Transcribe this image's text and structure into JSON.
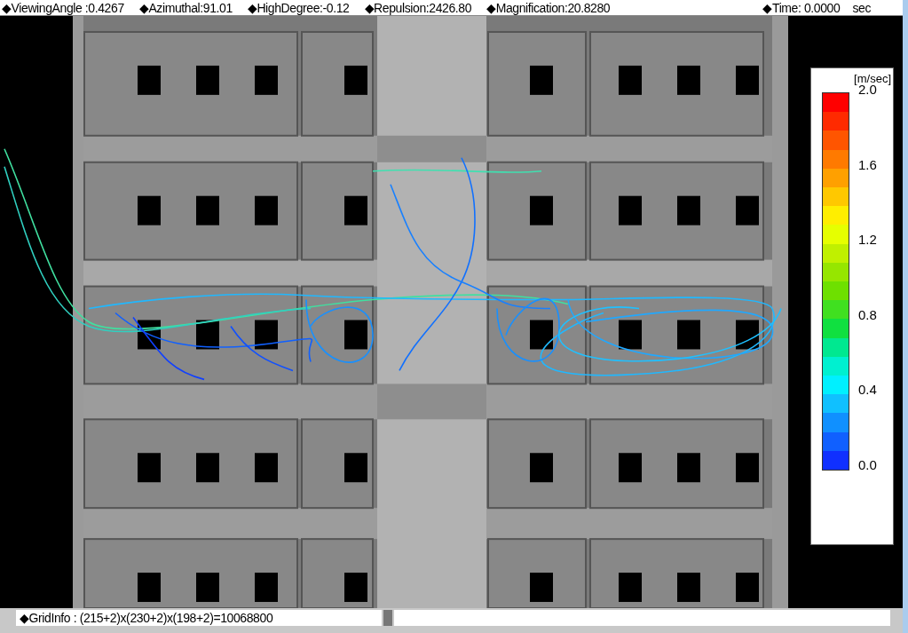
{
  "top_bar": {
    "readouts": [
      "◆ViewingAngle :0.4267",
      "◆Azimuthal:91.01",
      "◆HighDegree:-0.12",
      "◆Repulsion:2426.80",
      "◆Magnification:20.8280"
    ],
    "time": {
      "label": "◆Time: 0.0000",
      "unit": "sec"
    }
  },
  "legend": {
    "unit": "[m/sec]",
    "ticks": [
      "2.0",
      "1.6",
      "1.2",
      "0.8",
      "0.4",
      "0.0"
    ]
  },
  "status_bar": {
    "grid_info": "◆GridInfo : (215+2)x(230+2)x(198+2)=10068800"
  }
}
